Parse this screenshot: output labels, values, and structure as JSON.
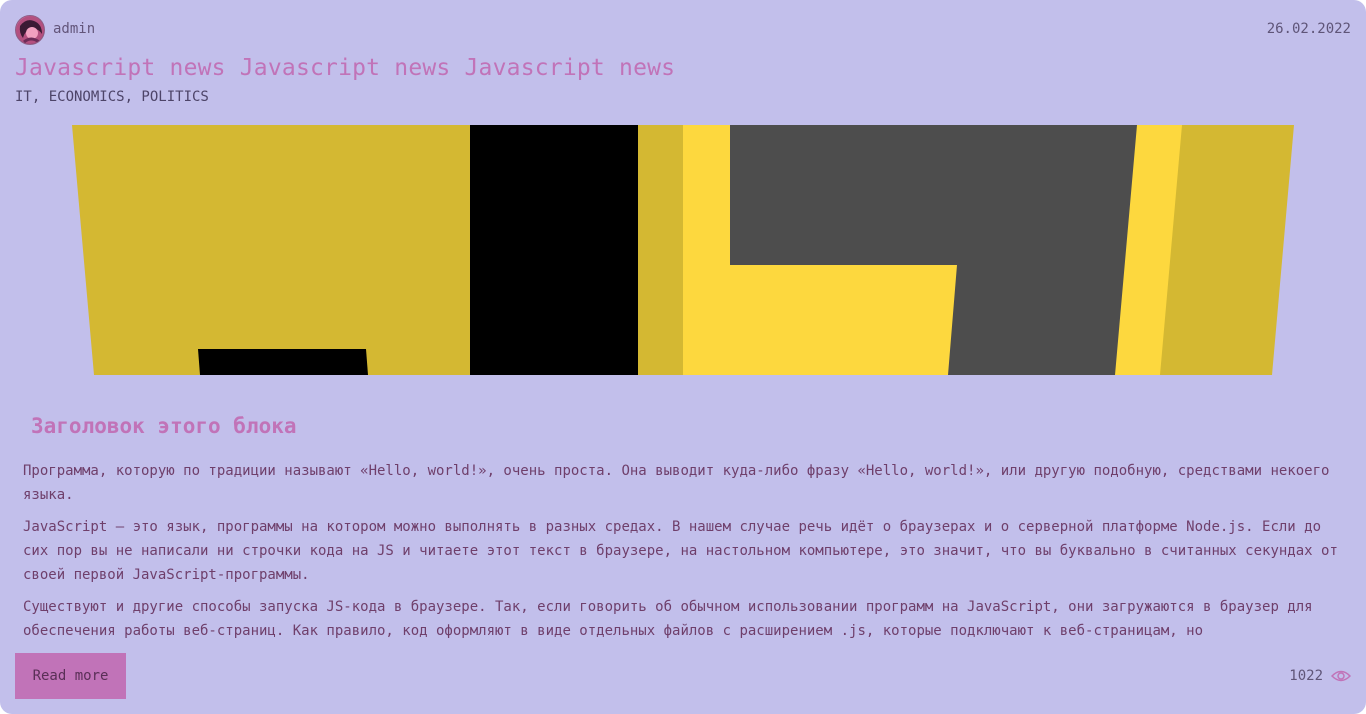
{
  "post": {
    "author": "admin",
    "date": "26.02.2022",
    "title": "Javascript news Javascript news Javascript news",
    "categories": "IT, ECONOMICS, POLITICS",
    "hero_image": "js-logo-perspective",
    "block_title": "Заголовок этого блока",
    "paragraphs": [
      "Программа, которую по традиции называют «Hello, world!», очень проста. Она выводит куда-либо фразу «Hello, world!», или другую подобную, средствами некоего языка.",
      "JavaScript — это язык, программы на котором можно выполнять в разных средах. В нашем случае речь идёт о браузерах и о серверной платформе Node.js. Если до сих пор вы не написали ни строчки кода на JS и читаете этот текст в браузере, на настольном компьютере, это значит, что вы буквально в считанных секундах от своей первой JavaScript-программы.",
      "Существуют и другие способы запуска JS-кода в браузере. Так, если говорить об обычном использовании программ на JavaScript, они загружаются в браузер для обеспечения работы веб-страниц. Как правило, код оформляют в виде отдельных файлов с расширением .js, которые подключают к веб-страницам, но"
    ],
    "read_more_label": "Read more",
    "views": "1022",
    "views_icon": "eye-icon"
  },
  "colors": {
    "background": "#c2bfeb",
    "accent": "#c173b8",
    "logo_yellow": "#d4b832",
    "logo_yellow_bright": "#fdd83e",
    "logo_dark": "#4d4d4d"
  }
}
